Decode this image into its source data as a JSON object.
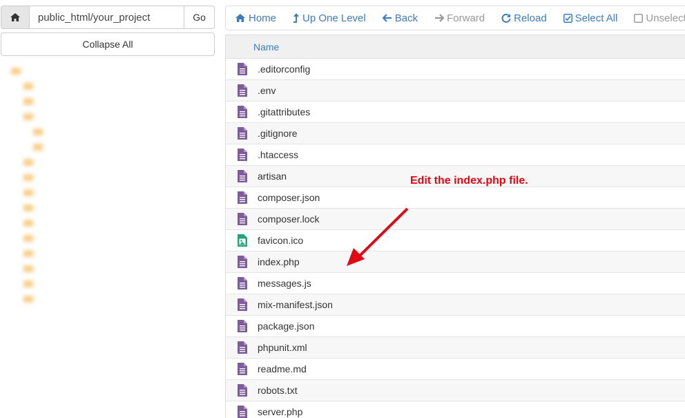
{
  "path_bar": {
    "path_value": "public_html/your_project",
    "go_label": "Go"
  },
  "collapse_label": "Collapse All",
  "toolbar": {
    "home": "Home",
    "up": "Up One Level",
    "back": "Back",
    "forward": "Forward",
    "reload": "Reload",
    "select_all": "Select All",
    "unselect_all": "Unselect A"
  },
  "table": {
    "header_name": "Name",
    "files": [
      {
        "name": ".editorconfig",
        "icon": "text-file-icon"
      },
      {
        "name": ".env",
        "icon": "text-file-icon"
      },
      {
        "name": ".gitattributes",
        "icon": "text-file-icon"
      },
      {
        "name": ".gitignore",
        "icon": "text-file-icon"
      },
      {
        "name": ".htaccess",
        "icon": "text-file-icon"
      },
      {
        "name": "artisan",
        "icon": "text-file-icon"
      },
      {
        "name": "composer.json",
        "icon": "text-file-icon"
      },
      {
        "name": "composer.lock",
        "icon": "text-file-icon"
      },
      {
        "name": "favicon.ico",
        "icon": "image-file-icon"
      },
      {
        "name": "index.php",
        "icon": "text-file-icon"
      },
      {
        "name": "messages.js",
        "icon": "text-file-icon"
      },
      {
        "name": "mix-manifest.json",
        "icon": "text-file-icon"
      },
      {
        "name": "package.json",
        "icon": "text-file-icon"
      },
      {
        "name": "phpunit.xml",
        "icon": "text-file-icon"
      },
      {
        "name": "readme.md",
        "icon": "text-file-icon"
      },
      {
        "name": "robots.txt",
        "icon": "text-file-icon"
      },
      {
        "name": "server.php",
        "icon": "text-file-icon"
      }
    ]
  },
  "annotation": "Edit the index.php file.",
  "colors": {
    "link": "#3c7bbd",
    "file_icon": "#7d5c99",
    "image_icon": "#26a37a",
    "annotation": "#e30613",
    "folder": "#f6c26b"
  }
}
